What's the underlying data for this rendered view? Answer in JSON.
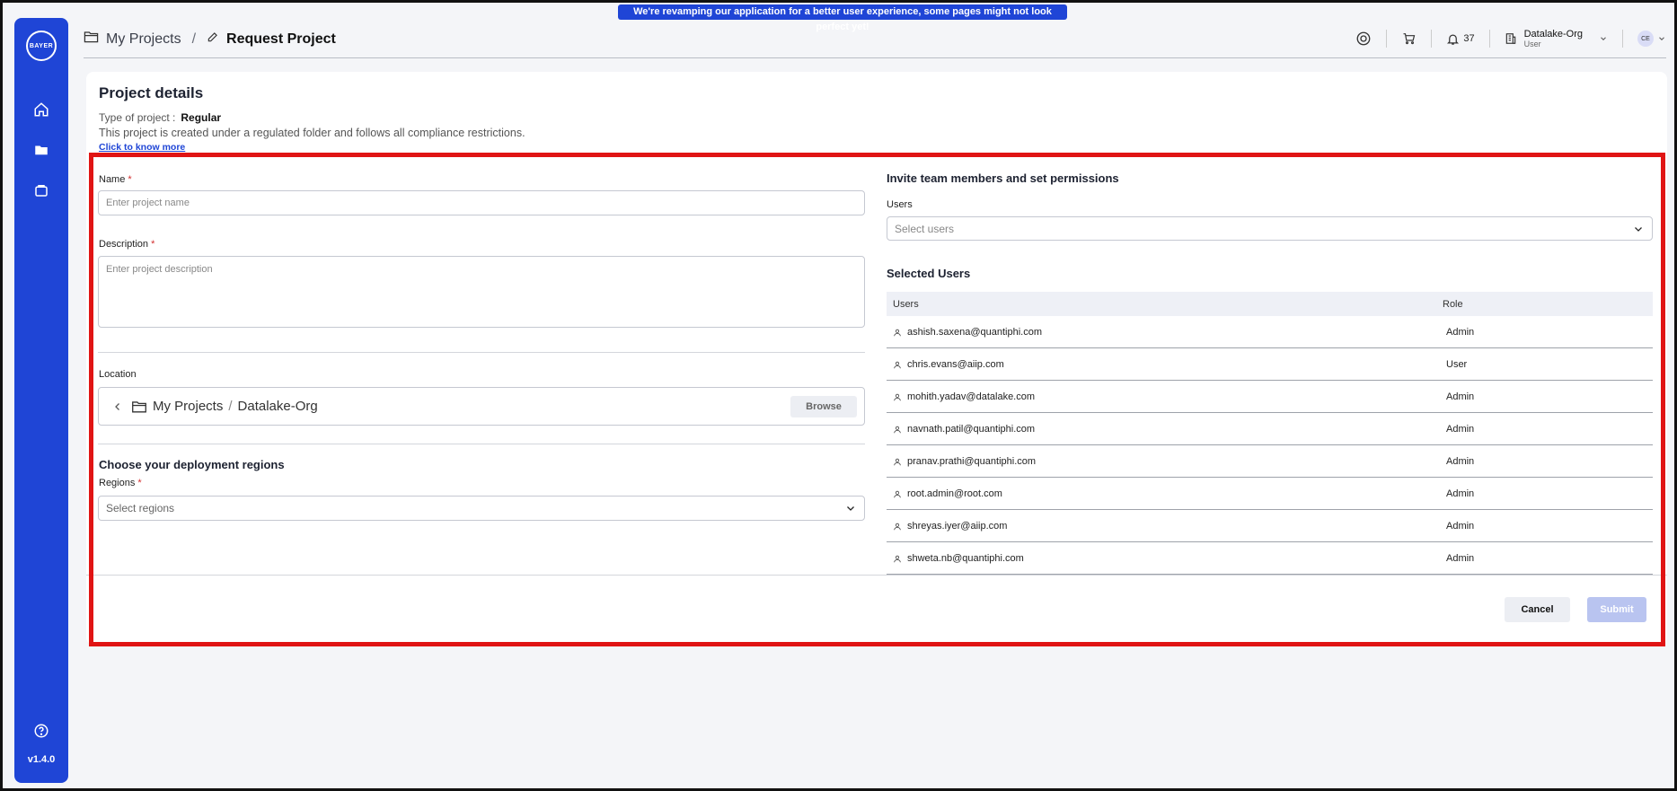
{
  "banner": "We're revamping our application for a better user experience, some pages might not look perfect yet!",
  "sidebar": {
    "logo_text": "BAYER",
    "version": "v1.4.0"
  },
  "header": {
    "crumb_parent": "My Projects",
    "crumb_current": "Request Project",
    "notifications_count": "37",
    "org_name": "Datalake-Org",
    "org_role": "User",
    "avatar_initials": "CE"
  },
  "project": {
    "title": "Project details",
    "type_label": "Type of project :",
    "type_value": "Regular",
    "compliance_text": "This project is created under a regulated folder and follows all compliance restrictions.",
    "know_more": "Click to know more"
  },
  "form": {
    "name_label": "Name",
    "name_placeholder": "Enter project name",
    "description_label": "Description",
    "description_placeholder": "Enter project description",
    "location_label": "Location",
    "location_root": "My Projects",
    "location_child": "Datalake-Org",
    "browse_label": "Browse",
    "regions_title": "Choose your deployment regions",
    "regions_label": "Regions",
    "regions_placeholder": "Select regions",
    "required_mark": "*"
  },
  "team": {
    "title": "Invite team members and set permissions",
    "users_label": "Users",
    "users_placeholder": "Select users",
    "selected_title": "Selected Users",
    "col_users": "Users",
    "col_role": "Role",
    "members": [
      {
        "email": "ashish.saxena@quantiphi.com",
        "role": "Admin"
      },
      {
        "email": "chris.evans@aiip.com",
        "role": "User"
      },
      {
        "email": "mohith.yadav@datalake.com",
        "role": "Admin"
      },
      {
        "email": "navnath.patil@quantiphi.com",
        "role": "Admin"
      },
      {
        "email": "pranav.prathi@quantiphi.com",
        "role": "Admin"
      },
      {
        "email": "root.admin@root.com",
        "role": "Admin"
      },
      {
        "email": "shreyas.iyer@aiip.com",
        "role": "Admin"
      },
      {
        "email": "shweta.nb@quantiphi.com",
        "role": "Admin"
      }
    ]
  },
  "actions": {
    "cancel": "Cancel",
    "submit": "Submit"
  }
}
